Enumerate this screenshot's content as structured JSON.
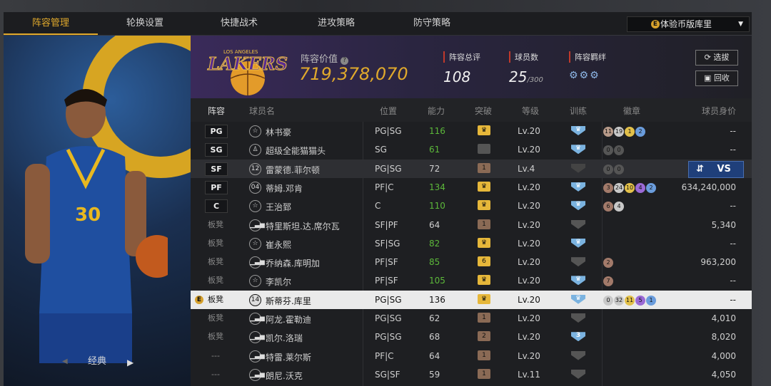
{
  "tabs": [
    {
      "label": "阵容管理",
      "active": true
    },
    {
      "label": "轮换设置"
    },
    {
      "label": "快捷战术"
    },
    {
      "label": "进攻策略"
    },
    {
      "label": "防守策略"
    }
  ],
  "dropdown": {
    "coin_icon": "coin-icon",
    "label": "体验币版库里"
  },
  "left_panel": {
    "edition": "经典"
  },
  "team": {
    "logo_text": "LAKERS",
    "logo_subtext": "LOS ANGELES",
    "value_label": "阵容价值",
    "value": "719,378,070",
    "rating_label": "阵容总评",
    "rating": "108",
    "count_label": "球员数",
    "count": "25",
    "count_max": "/300",
    "bond_label": "阵容羁绊"
  },
  "buttons": {
    "scout": "选拔",
    "recycle": "回收",
    "vs": "VS"
  },
  "columns": {
    "pos": "阵容",
    "name": "球员名",
    "position": "位置",
    "ability": "能力",
    "breakthrough": "突破",
    "level": "等级",
    "training": "训练",
    "badges": "徽章",
    "worth": "球员身价"
  },
  "players": [
    {
      "slot": "PG",
      "icon": "star",
      "name": "林书豪",
      "position": "PG|SG",
      "ability": "116",
      "green": true,
      "bk": "♛",
      "bkcolor": "#e6b73a",
      "level": "Lv.20",
      "train": "♛",
      "traincolor": "#7bb3e0",
      "badges": [
        [
          "11",
          "#b89b8a"
        ],
        [
          "19",
          "#c8c8c8"
        ],
        [
          "1",
          "#e2c04a"
        ],
        [
          "2",
          "#6a9cdc"
        ]
      ],
      "worth": "--"
    },
    {
      "slot": "SG",
      "icon": "person",
      "name": "超级全能猫猫头",
      "position": "SG",
      "ability": "61",
      "green": true,
      "bk": "",
      "bkcolor": "#555",
      "level": "Lv.20",
      "train": "♛",
      "traincolor": "#7bb3e0",
      "badges": [
        [
          "0",
          "#555"
        ],
        [
          "0",
          "#555"
        ]
      ],
      "worth": "--"
    },
    {
      "slot": "SF",
      "icon": "12",
      "name": "雷蒙德.菲尔顿",
      "position": "PG|SG",
      "ability": "72",
      "green": false,
      "bk": "1",
      "bkcolor": "#8a6a55",
      "level": "Lv.4",
      "train": "",
      "traincolor": "#444",
      "badges": [
        [
          "0",
          "#555"
        ],
        [
          "0",
          "#555"
        ]
      ],
      "worth": "--",
      "hl": true
    },
    {
      "slot": "PF",
      "icon": "04",
      "name": "蒂姆.邓肯",
      "position": "PF|C",
      "ability": "134",
      "green": true,
      "bk": "♛",
      "bkcolor": "#e6b73a",
      "level": "Lv.20",
      "train": "♛",
      "traincolor": "#7bb3e0",
      "badges": [
        [
          "3",
          "#a27a6a"
        ],
        [
          "24",
          "#c8c8c8"
        ],
        [
          "10",
          "#e2c04a"
        ],
        [
          "4",
          "#9b6ad6"
        ],
        [
          "2",
          "#6a9cdc"
        ]
      ],
      "worth": "634,240,000"
    },
    {
      "slot": "C",
      "icon": "star",
      "name": "王治郅",
      "position": "C",
      "ability": "110",
      "green": true,
      "bk": "♛",
      "bkcolor": "#e6b73a",
      "level": "Lv.20",
      "train": "♛",
      "traincolor": "#7bb3e0",
      "badges": [
        [
          "6",
          "#a27a6a"
        ],
        [
          "4",
          "#c8c8c8"
        ]
      ],
      "worth": "--"
    },
    {
      "slot": "板凳",
      "icon": "bars",
      "name": "特里斯坦.达.席尔瓦",
      "position": "SF|PF",
      "ability": "64",
      "green": false,
      "bk": "1",
      "bkcolor": "#8a6a55",
      "level": "Lv.20",
      "train": "",
      "traincolor": "#555",
      "badges": [],
      "worth": "5,340"
    },
    {
      "slot": "板凳",
      "icon": "star",
      "name": "崔永熙",
      "position": "SF|SG",
      "ability": "82",
      "green": true,
      "bk": "♛",
      "bkcolor": "#e6b73a",
      "level": "Lv.20",
      "train": "♛",
      "traincolor": "#7bb3e0",
      "badges": [],
      "worth": "--"
    },
    {
      "slot": "板凳",
      "icon": "bars",
      "name": "乔纳森.库明加",
      "position": "PF|SF",
      "ability": "85",
      "green": true,
      "bk": "6",
      "bkcolor": "#e6b73a",
      "level": "Lv.20",
      "train": "",
      "traincolor": "#555",
      "badges": [
        [
          "2",
          "#a27a6a"
        ]
      ],
      "worth": "963,200"
    },
    {
      "slot": "板凳",
      "icon": "star",
      "name": "李凯尔",
      "position": "PF|SF",
      "ability": "105",
      "green": true,
      "bk": "♛",
      "bkcolor": "#e6b73a",
      "level": "Lv.20",
      "train": "♛",
      "traincolor": "#7bb3e0",
      "badges": [
        [
          "7",
          "#a27a6a"
        ]
      ],
      "worth": "--"
    },
    {
      "slot": "板凳",
      "icon": "14",
      "name": "斯蒂芬.库里",
      "position": "PG|SG",
      "ability": "136",
      "green": false,
      "bk": "♛",
      "bkcolor": "#e6b73a",
      "level": "Lv.20",
      "train": "♛",
      "traincolor": "#7bb3e0",
      "badges": [
        [
          "0",
          "#c8c8c8"
        ],
        [
          "32",
          "#c8c8c8"
        ],
        [
          "11",
          "#e2c04a"
        ],
        [
          "5",
          "#9b6ad6"
        ],
        [
          "1",
          "#6a9cdc"
        ]
      ],
      "worth": "--",
      "sel": true
    },
    {
      "slot": "板凳",
      "icon": "bars",
      "name": "阿龙.霍勒迪",
      "position": "PG|SG",
      "ability": "62",
      "green": false,
      "bk": "1",
      "bkcolor": "#8a6a55",
      "level": "Lv.20",
      "train": "",
      "traincolor": "#555",
      "badges": [],
      "worth": "4,010"
    },
    {
      "slot": "板凳",
      "icon": "bars",
      "name": "凯尔.洛瑞",
      "position": "PG|SG",
      "ability": "68",
      "green": false,
      "bk": "2",
      "bkcolor": "#8a6a55",
      "level": "Lv.20",
      "train": "3",
      "traincolor": "#7bb3e0",
      "badges": [],
      "worth": "8,020"
    },
    {
      "slot": "---",
      "icon": "bars",
      "name": "特雷.莱尔斯",
      "position": "PF|C",
      "ability": "64",
      "green": false,
      "bk": "1",
      "bkcolor": "#8a6a55",
      "level": "Lv.20",
      "train": "",
      "traincolor": "#555",
      "badges": [],
      "worth": "4,000"
    },
    {
      "slot": "---",
      "icon": "bars",
      "name": "朗尼.沃克",
      "position": "SG|SF",
      "ability": "59",
      "green": false,
      "bk": "1",
      "bkcolor": "#8a6a55",
      "level": "Lv.11",
      "train": "",
      "traincolor": "#555",
      "badges": [],
      "worth": "4,050"
    }
  ]
}
